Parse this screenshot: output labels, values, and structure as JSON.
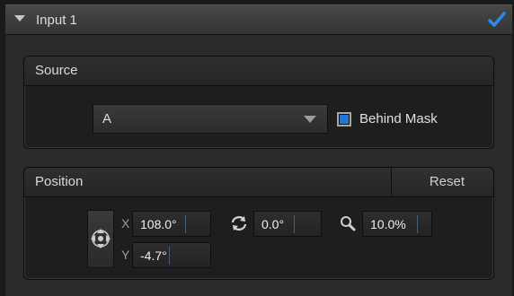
{
  "header": {
    "title": "Input 1",
    "enabled": true
  },
  "source": {
    "label": "Source",
    "dropdown_value": "A",
    "behind_mask_label": "Behind Mask",
    "behind_mask_checked": true
  },
  "position": {
    "label": "Position",
    "reset_label": "Reset",
    "x_label": "X",
    "y_label": "Y",
    "x_value": "108.0°",
    "y_value": "-4.7°",
    "rotation_value": "0.0°",
    "zoom_value": "10.0%"
  },
  "colors": {
    "accent": "#1f78d6",
    "check": "#2d8ae6"
  }
}
